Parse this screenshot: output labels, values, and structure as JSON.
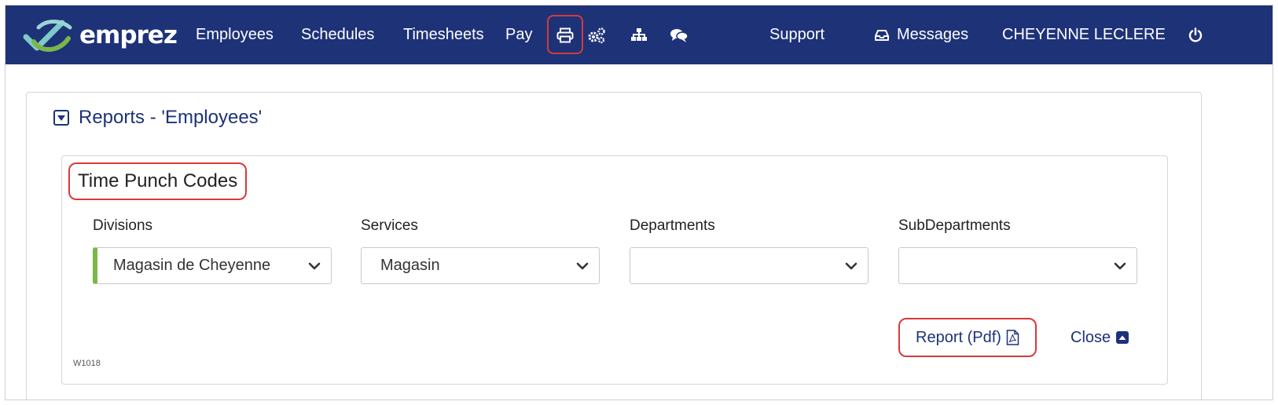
{
  "brand": {
    "name": "emprez"
  },
  "nav": {
    "employees": "Employees",
    "schedules": "Schedules",
    "timesheets": "Timesheets",
    "pay": "Pay",
    "support": "Support",
    "messages": "Messages",
    "user": "CHEYENNE LECLERE",
    "icons": [
      "printer-icon",
      "cogs-icon",
      "sitemap-icon",
      "comments-icon",
      "inbox-icon",
      "power-icon"
    ]
  },
  "panel": {
    "title": "Reports - 'Employees'"
  },
  "report": {
    "section_title": "Time Punch Codes",
    "fields": {
      "divisions": {
        "label": "Divisions",
        "value": "Magasin de Cheyenne"
      },
      "services": {
        "label": "Services",
        "value": "Magasin"
      },
      "departments": {
        "label": "Departments",
        "value": ""
      },
      "subdepartments": {
        "label": "SubDepartments",
        "value": ""
      }
    },
    "report_button": "Report (Pdf)",
    "close_button": "Close",
    "code": "W1018"
  },
  "colors": {
    "navbar": "#1e3278",
    "accent_green": "#7ab648",
    "highlight_red": "#d63a3a",
    "link_blue": "#1e3278"
  }
}
